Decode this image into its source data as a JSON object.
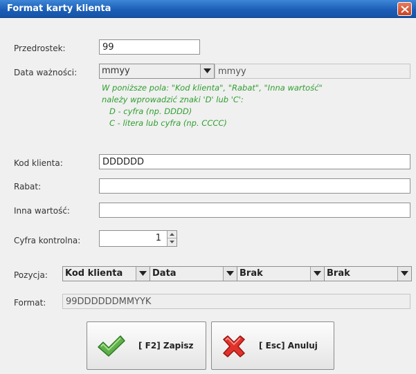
{
  "window": {
    "title": "Format karty klienta"
  },
  "fields": {
    "prefix": {
      "label": "Przedrostek:",
      "value": "99"
    },
    "expiry": {
      "label": "Data ważności:",
      "combo_value": "mmyy",
      "text_value": "mmyy"
    },
    "info_lines": [
      "W poniższe pola: \"Kod klienta\", \"Rabat\", \"Inna wartość\"",
      "należy wprowadzić znaki 'D' lub 'C':",
      "   D - cyfra (np. DDDD)",
      "   C - litera lub cyfra (np. CCCC)"
    ],
    "client_code": {
      "label": "Kod klienta:",
      "value": "DDDDDD"
    },
    "discount": {
      "label": "Rabat:",
      "value": ""
    },
    "other_value": {
      "label": "Inna wartość:",
      "value": ""
    },
    "check_digit": {
      "label": "Cyfra kontrolna:",
      "value": "1"
    },
    "position": {
      "label": "Pozycja:",
      "options": [
        "Kod klienta",
        "Data",
        "Brak",
        "Brak"
      ]
    },
    "format": {
      "label": "Format:",
      "value": "99DDDDDDMMYYK"
    }
  },
  "buttons": {
    "save": {
      "label": "[ F2] Zapisz",
      "icon": "checkmark-icon"
    },
    "cancel": {
      "label": "[ Esc] Anuluj",
      "icon": "red-x-icon"
    }
  },
  "colors": {
    "title_bar": "#1c5fb8",
    "info_text": "#2f9e2f",
    "close_button": "#c8431f"
  }
}
